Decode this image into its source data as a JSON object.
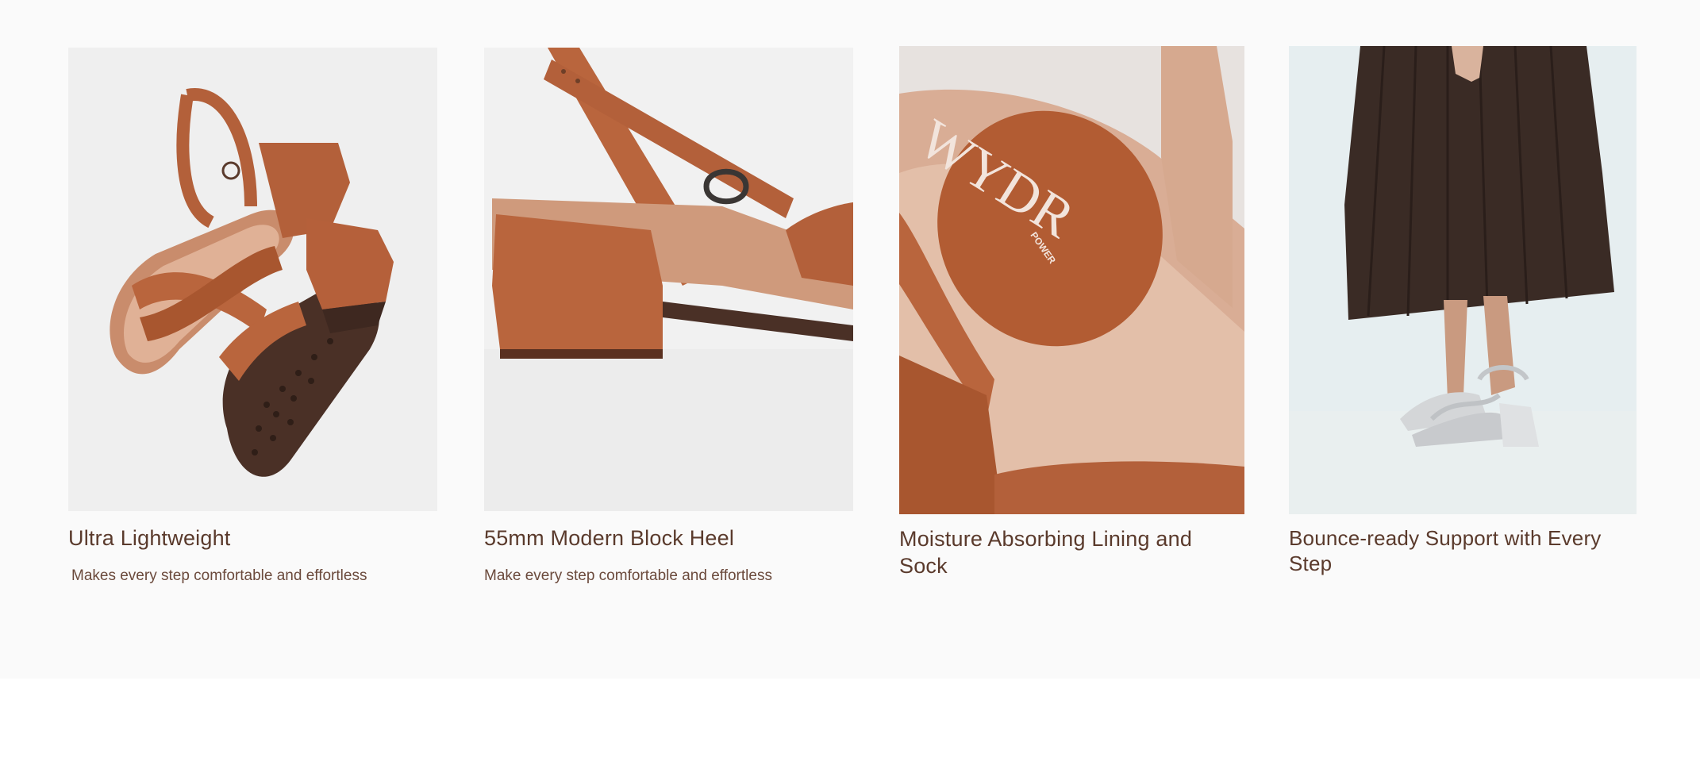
{
  "features": [
    {
      "title": "Ultra Lightweight",
      "description": "Makes every step comfortable and effortless",
      "image_alt": "Tan strappy block heel sandal with sole visible"
    },
    {
      "title": "55mm Modern Block Heel",
      "description": "Make every step comfortable and effortless",
      "image_alt": "Close-up of tan block heel and ankle strap buckle"
    },
    {
      "title": "Moisture Absorbing Lining and Sock",
      "description": "",
      "image_alt": "Close-up of cushioned footbed with logo",
      "logo_text": "WYDR",
      "logo_subtext": "POWER"
    },
    {
      "title": "Bounce-ready Support with Every Step",
      "description": "",
      "image_alt": "Model in dark pleated skirt wearing silver block heel sandals"
    }
  ],
  "colors": {
    "title_text": "#5a3a2c",
    "tan_leather": "#b96740",
    "page_bg": "#fafafa"
  }
}
